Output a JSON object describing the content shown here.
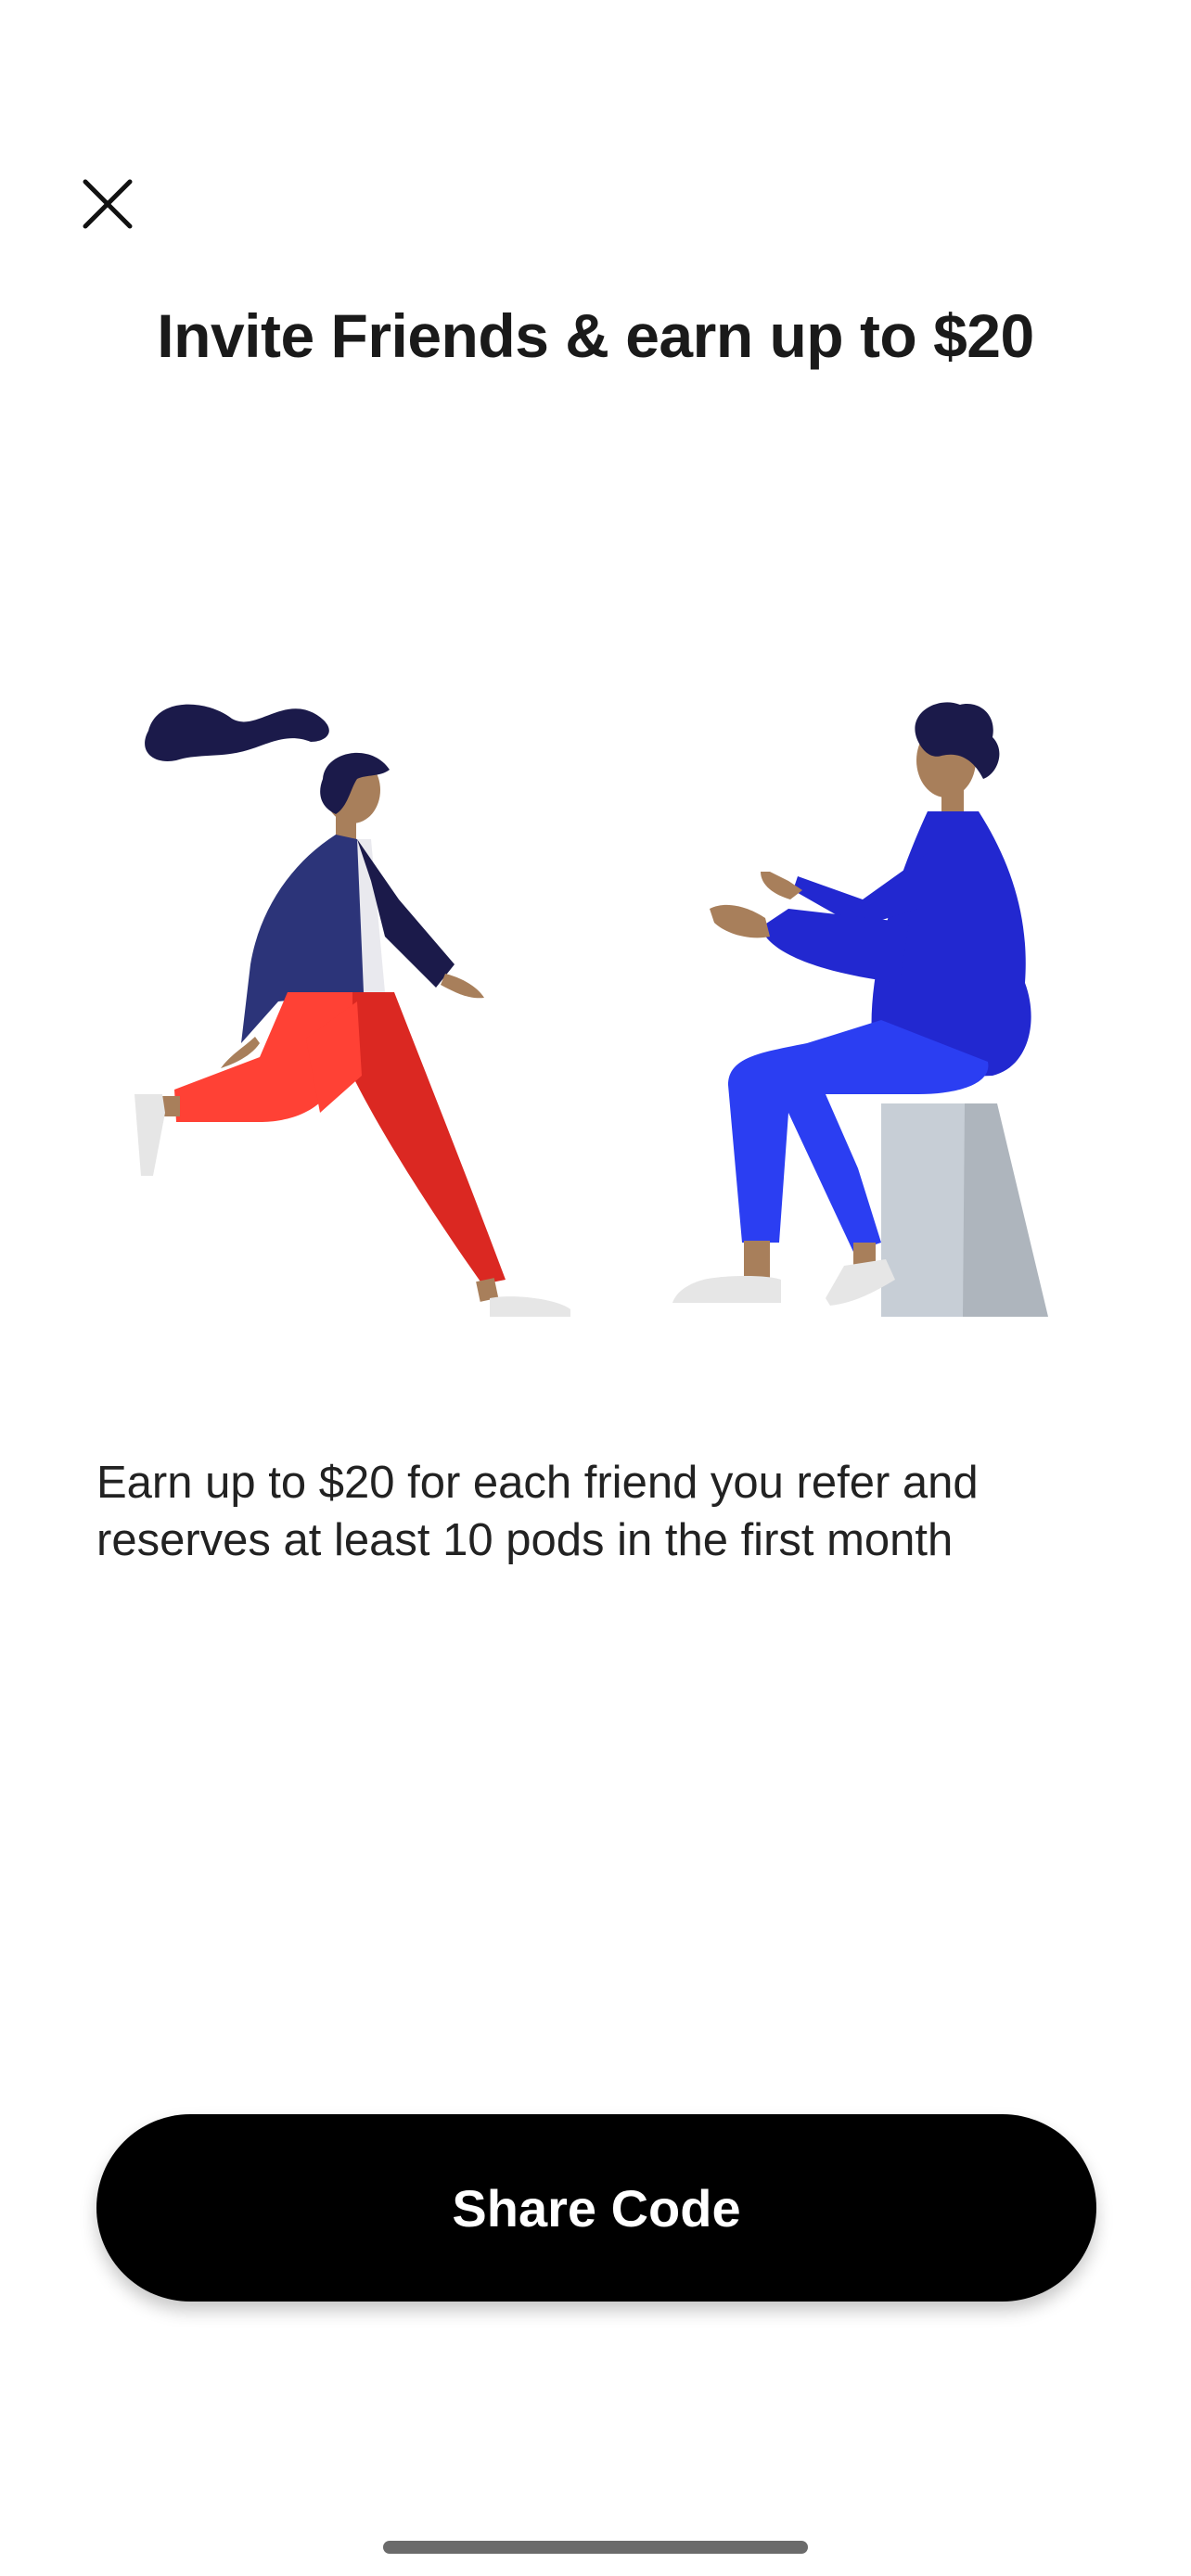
{
  "header": {
    "close_icon": "close-icon",
    "title": "Invite Friends & earn up to $20"
  },
  "illustration": {
    "icon": "two-people-talking-illustration",
    "colors": {
      "hair": "#1b1a4a",
      "skin": "#a87f5b",
      "jacket": "#2c3479",
      "pants_light": "#ff4135",
      "pants_dark": "#db2822",
      "shirt_blue": "#2228d0",
      "pants_blue": "#2b3ef2",
      "seat_light": "#c7ced6",
      "seat_dark": "#aeb5bd",
      "shoes": "#e6e6e6"
    }
  },
  "body": {
    "description": "Earn up to $20 for each friend you refer and reserves at least 10 pods in the first month"
  },
  "actions": {
    "share_label": "Share Code"
  },
  "colors": {
    "primary_button": "#000000",
    "text": "#1a1a1a"
  }
}
